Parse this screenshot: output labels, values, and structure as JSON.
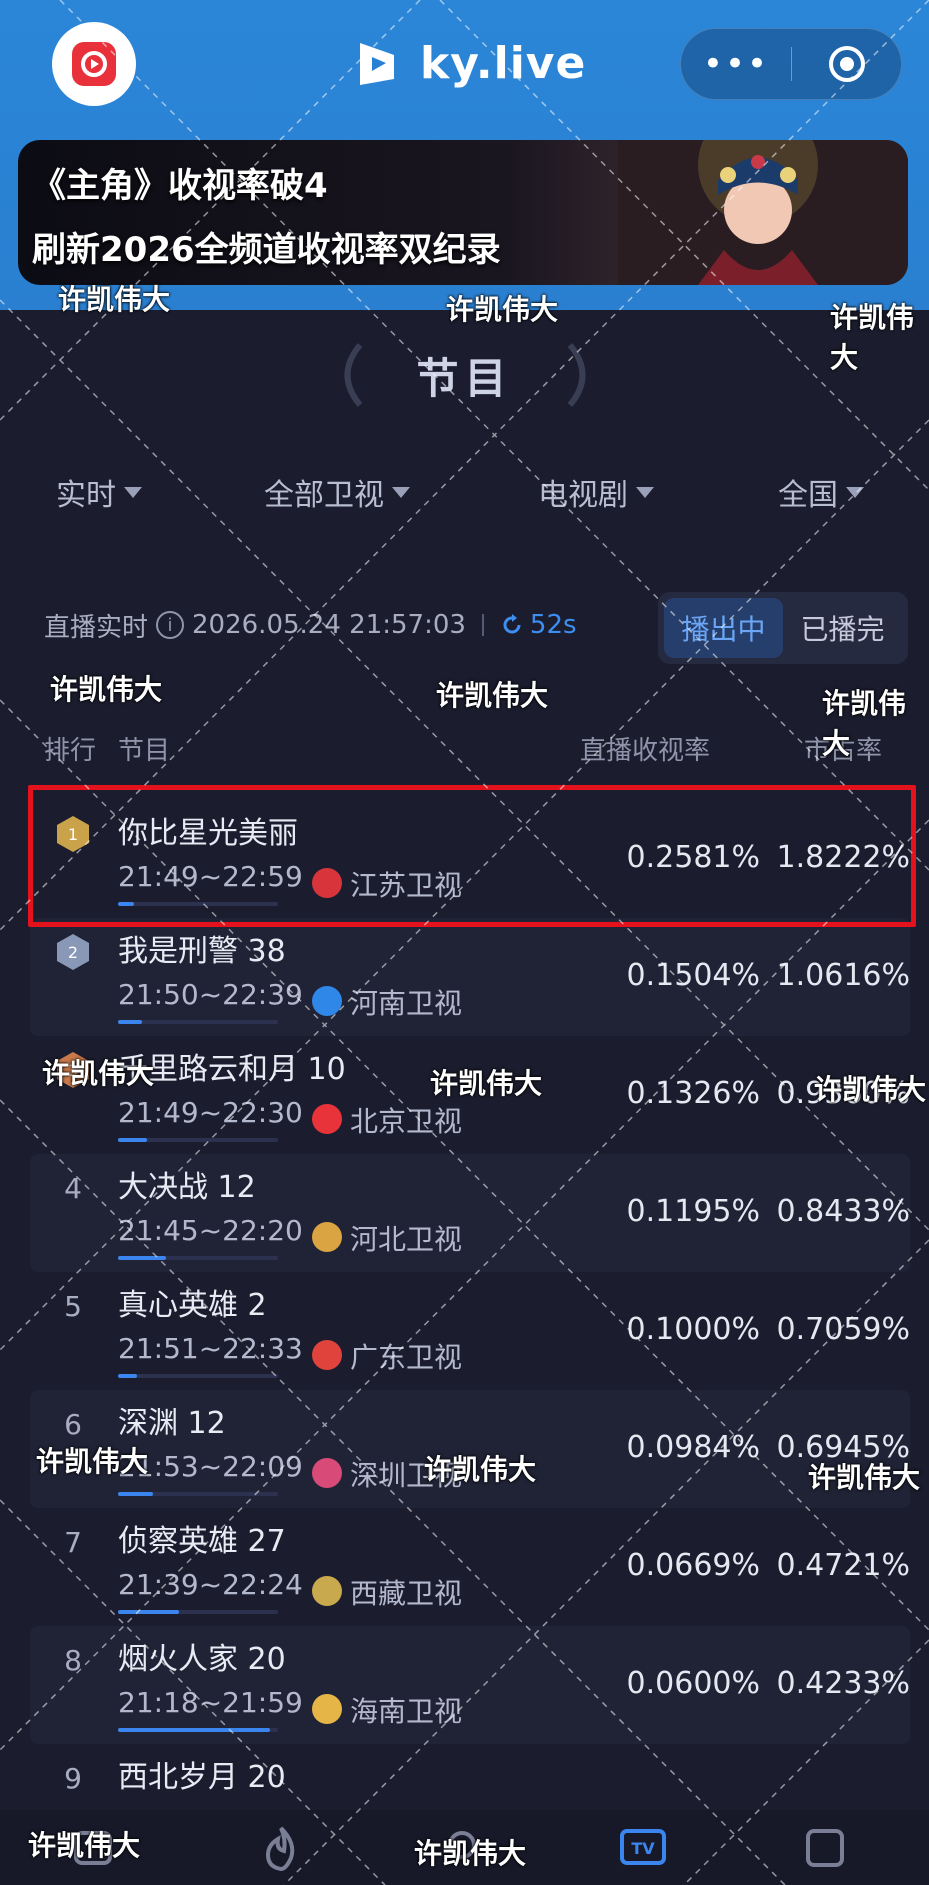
{
  "header": {
    "brand": "ky.live",
    "more_label": "•••",
    "colors": {
      "bar": "#2a80d2",
      "logo_red": "#e8313a"
    }
  },
  "banner": {
    "line1": "《主角》收视率破4",
    "line2": "刷新2026全频道收视率双纪录"
  },
  "section": {
    "title": "节目"
  },
  "filters": [
    {
      "label": "实时"
    },
    {
      "label": "全部卫视"
    },
    {
      "label": "电视剧"
    },
    {
      "label": "全国"
    }
  ],
  "status": {
    "live_label": "直播实时",
    "datetime": "2026.05.24 21:57:03",
    "countdown": "52s",
    "toggle_on_air": "播出中",
    "toggle_aired": "已播完"
  },
  "columns": {
    "rank": "排行",
    "program": "节目",
    "rating": "直播收视率",
    "share": "市占率"
  },
  "rows": [
    {
      "rank": "1",
      "title": "你比星光美丽",
      "time": "21:49~22:59",
      "channel": "江苏卫视",
      "rating": "0.2581%",
      "share": "1.8222%",
      "progress": 0.1,
      "logo_color": "#d8343b"
    },
    {
      "rank": "2",
      "title": "我是刑警 38",
      "time": "21:50~22:39",
      "channel": "河南卫视",
      "rating": "0.1504%",
      "share": "1.0616%",
      "progress": 0.15,
      "logo_color": "#2f87e8"
    },
    {
      "rank": "3",
      "title": "千里路云和月 10",
      "time": "21:49~22:30",
      "channel": "北京卫视",
      "rating": "0.1326%",
      "share": "0.9360%",
      "progress": 0.18,
      "logo_color": "#e8333b"
    },
    {
      "rank": "4",
      "title": "大决战 12",
      "time": "21:45~22:20",
      "channel": "河北卫视",
      "rating": "0.1195%",
      "share": "0.8433%",
      "progress": 0.3,
      "logo_color": "#d9a441"
    },
    {
      "rank": "5",
      "title": "真心英雄 2",
      "time": "21:51~22:33",
      "channel": "广东卫视",
      "rating": "0.1000%",
      "share": "0.7059%",
      "progress": 0.12,
      "logo_color": "#e0423c"
    },
    {
      "rank": "6",
      "title": "深渊 12",
      "time": "21:53~22:09",
      "channel": "深圳卫视",
      "rating": "0.0984%",
      "share": "0.6945%",
      "progress": 0.22,
      "logo_color": "#d84a78"
    },
    {
      "rank": "7",
      "title": "侦察英雄 27",
      "time": "21:39~22:24",
      "channel": "西藏卫视",
      "rating": "0.0669%",
      "share": "0.4721%",
      "progress": 0.38,
      "logo_color": "#c9a94d"
    },
    {
      "rank": "8",
      "title": "烟火人家 20",
      "time": "21:18~21:59",
      "channel": "海南卫视",
      "rating": "0.0600%",
      "share": "0.4233%",
      "progress": 0.95,
      "logo_color": "#e6b548"
    },
    {
      "rank": "9",
      "title": "西北岁月 20",
      "time": "",
      "channel": "",
      "rating": "",
      "share": "",
      "progress": 0,
      "logo_color": "#888888"
    }
  ],
  "watermark_text": "许凯伟大"
}
